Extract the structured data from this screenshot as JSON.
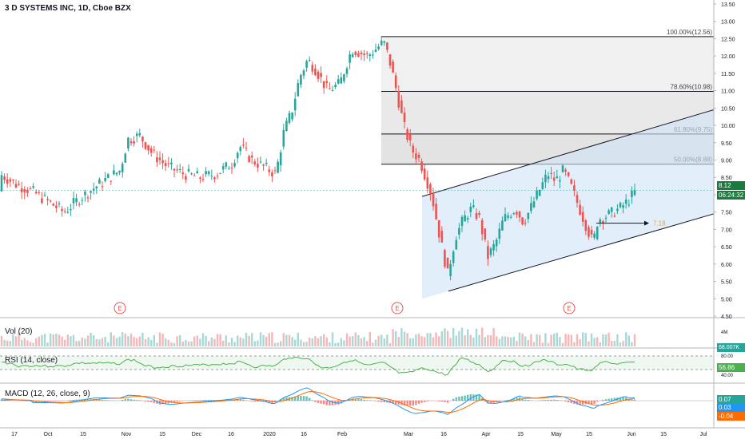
{
  "chart_data": {
    "type": "candlestick",
    "title": "3 D SYSTEMS INC, 1D, Cboe BZX",
    "price_axis": {
      "ticks": [
        "13.50",
        "13.00",
        "12.50",
        "12.00",
        "11.50",
        "11.00",
        "10.50",
        "10.00",
        "9.50",
        "9.00",
        "8.50",
        "8.00",
        "7.50",
        "7.00",
        "6.50",
        "6.00",
        "5.50",
        "5.00",
        "4.50"
      ],
      "range": [
        4.35,
        13.6
      ]
    },
    "x_axis": {
      "ticks": [
        "17",
        "Oct",
        "15",
        "Nov",
        "15",
        "Dec",
        "16",
        "2020",
        "16",
        "Feb",
        "Mar",
        "16",
        "Apr",
        "15",
        "May",
        "15",
        "Jun",
        "15",
        "Jul"
      ]
    },
    "last_price": "8.12",
    "countdown": "06:24:32",
    "fibonacci": [
      {
        "label": "100.00%(12.56)",
        "price": 12.56
      },
      {
        "label": "78.60%(10.98)",
        "price": 10.98
      },
      {
        "label": "61.80%(9.75)",
        "price": 9.75
      },
      {
        "label": "50.00%(8.88)",
        "price": 8.88
      }
    ],
    "target_label": "7.18",
    "earnings_marker": "E",
    "indicators": {
      "volume": {
        "label": "Vol (20)",
        "axis_ticks": [
          "4M"
        ],
        "value": "68.007K"
      },
      "rsi": {
        "label": "RSI (14, close)",
        "axis_ticks": [
          "80.00",
          "40.00"
        ],
        "value": "56.86"
      },
      "macd": {
        "label": "MACD (12, 26, close, 9)",
        "values": [
          "0.07",
          "0.03",
          "-0.04"
        ]
      }
    },
    "colors": {
      "up": "#26a69a",
      "down": "#ef5350",
      "channel_fill": "#cfe4f7",
      "fib_fill": "#e0e0e0",
      "macd_line": "#2196f3",
      "signal_line": "#ff6d00",
      "rsi_line": "#4caf50",
      "target": "#e8a53a"
    }
  }
}
